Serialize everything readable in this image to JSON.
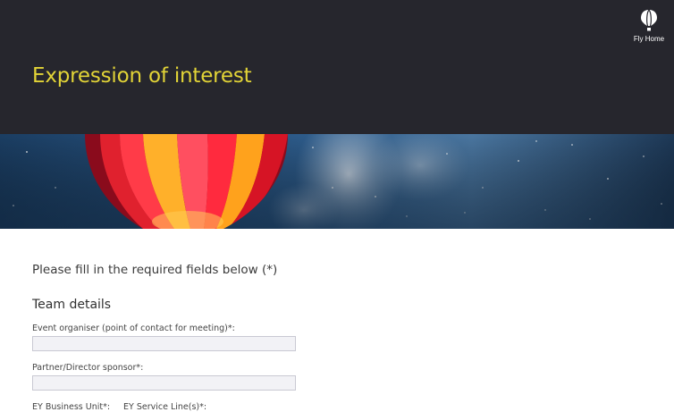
{
  "header": {
    "title": "Expression of interest",
    "home_label": "Fly Home",
    "home_icon": "balloon-icon",
    "title_color": "#e2d437",
    "background": "#26262d"
  },
  "form": {
    "intro": "Please fill in the required fields below (*)",
    "section_title": "Team details",
    "fields": [
      {
        "label": "Event organiser (point of contact for meeting)*:",
        "value": "",
        "placeholder": ""
      },
      {
        "label": "Partner/Director sponsor*:",
        "value": "",
        "placeholder": ""
      },
      {
        "label": "EY Business Unit*:"
      },
      {
        "label": "EY Service Line(s)*:"
      }
    ]
  }
}
